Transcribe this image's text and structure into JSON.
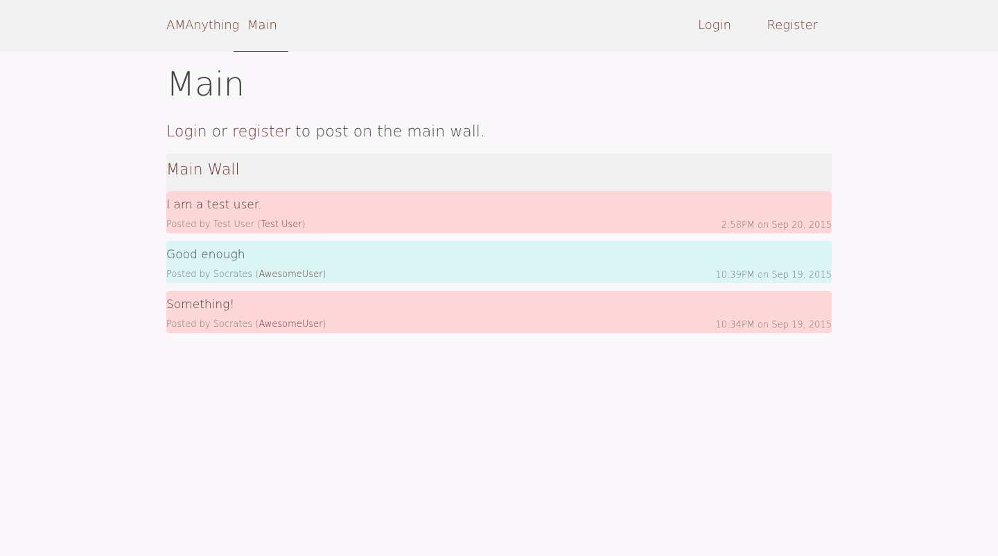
{
  "nav": {
    "brand": "AMAnything",
    "main": "Main",
    "login": "Login",
    "register": "Register"
  },
  "page": {
    "title": "Main",
    "prompt_login": "Login",
    "prompt_or": " or ",
    "prompt_register": "register",
    "prompt_rest": " to post on the main wall."
  },
  "wall": {
    "title": "Main Wall",
    "posts": [
      {
        "text": "I am a test user.",
        "posted_by": "Posted by Test User (",
        "username": "Test User",
        "close": ")",
        "time": "2:58PM on Sep 20, 2015",
        "color": "#fdd7d7"
      },
      {
        "text": "Good enough",
        "posted_by": "Posted by Socrates (",
        "username": "AwesomeUser",
        "close": ")",
        "time": "10:39PM on Sep 19, 2015",
        "color": "#daf5f3"
      },
      {
        "text": "Something!",
        "posted_by": "Posted by Socrates (",
        "username": "AwesomeUser",
        "close": ")",
        "time": "10:34PM on Sep 19, 2015",
        "color": "#fdd7d7"
      }
    ]
  },
  "colors": {
    "accent": "#6e3b2f",
    "navbar": "#f3f2f3",
    "background": "#f9f7fa"
  }
}
